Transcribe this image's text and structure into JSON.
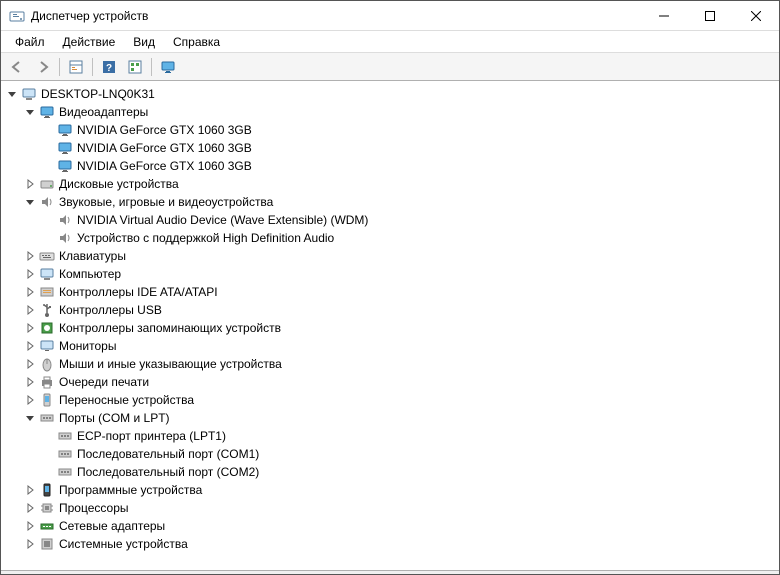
{
  "window": {
    "title": "Диспетчер устройств"
  },
  "menu": {
    "file": "Файл",
    "action": "Действие",
    "view": "Вид",
    "help": "Справка"
  },
  "tree": {
    "root": "DESKTOP-LNQ0K31",
    "categories": [
      {
        "label": "Видеоадаптеры",
        "icon": "display",
        "expanded": true,
        "children": [
          {
            "label": "NVIDIA GeForce GTX 1060 3GB",
            "icon": "display"
          },
          {
            "label": "NVIDIA GeForce GTX 1060 3GB",
            "icon": "display"
          },
          {
            "label": "NVIDIA GeForce GTX 1060 3GB",
            "icon": "display"
          }
        ]
      },
      {
        "label": "Дисковые устройства",
        "icon": "disk",
        "expanded": false
      },
      {
        "label": "Звуковые, игровые и видеоустройства",
        "icon": "audio",
        "expanded": true,
        "children": [
          {
            "label": "NVIDIA Virtual Audio Device (Wave Extensible) (WDM)",
            "icon": "audio"
          },
          {
            "label": "Устройство с поддержкой High Definition Audio",
            "icon": "audio"
          }
        ]
      },
      {
        "label": "Клавиатуры",
        "icon": "keyboard",
        "expanded": false
      },
      {
        "label": "Компьютер",
        "icon": "computer",
        "expanded": false
      },
      {
        "label": "Контроллеры IDE ATA/ATAPI",
        "icon": "ide",
        "expanded": false
      },
      {
        "label": "Контроллеры USB",
        "icon": "usb",
        "expanded": false
      },
      {
        "label": "Контроллеры запоминающих устройств",
        "icon": "storage",
        "expanded": false
      },
      {
        "label": "Мониторы",
        "icon": "monitor",
        "expanded": false
      },
      {
        "label": "Мыши и иные указывающие устройства",
        "icon": "mouse",
        "expanded": false
      },
      {
        "label": "Очереди печати",
        "icon": "printer",
        "expanded": false
      },
      {
        "label": "Переносные устройства",
        "icon": "portable",
        "expanded": false
      },
      {
        "label": "Порты (COM и LPT)",
        "icon": "port",
        "expanded": true,
        "children": [
          {
            "label": "ECP-порт принтера (LPT1)",
            "icon": "port"
          },
          {
            "label": "Последовательный порт (COM1)",
            "icon": "port"
          },
          {
            "label": "Последовательный порт (COM2)",
            "icon": "port"
          }
        ]
      },
      {
        "label": "Программные устройства",
        "icon": "software",
        "expanded": false
      },
      {
        "label": "Процессоры",
        "icon": "cpu",
        "expanded": false
      },
      {
        "label": "Сетевые адаптеры",
        "icon": "network",
        "expanded": false
      },
      {
        "label": "Системные устройства",
        "icon": "system",
        "expanded": false
      }
    ]
  }
}
